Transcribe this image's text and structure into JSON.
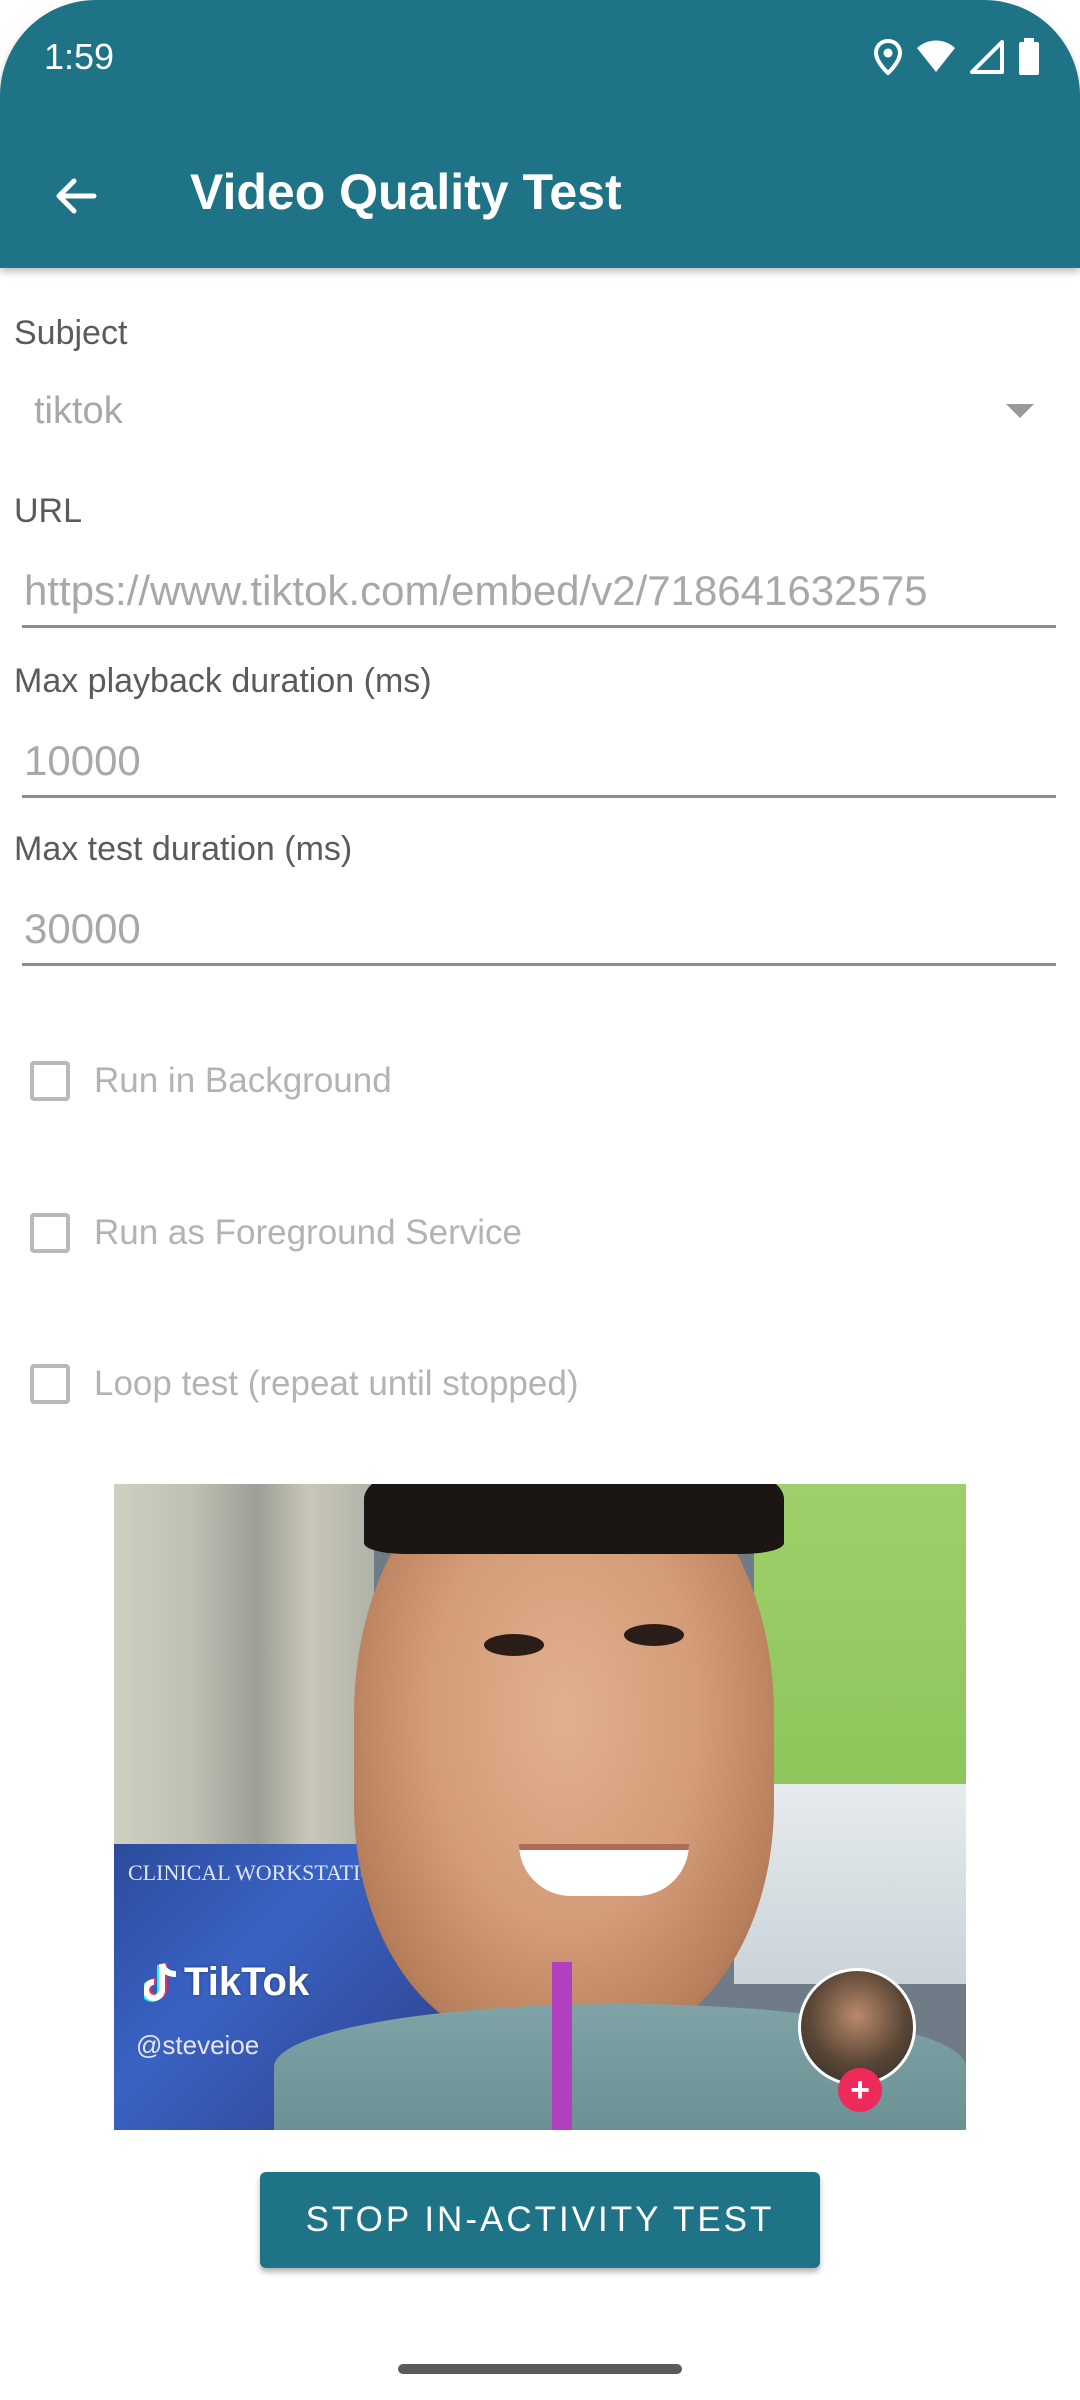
{
  "status_bar": {
    "time": "1:59",
    "icons": [
      "location-icon",
      "wifi-icon",
      "signal-icon",
      "battery-icon"
    ]
  },
  "app_bar": {
    "title": "Video Quality Test",
    "back_icon": "arrow-back-icon"
  },
  "form": {
    "subject": {
      "label": "Subject",
      "value": "tiktok"
    },
    "url": {
      "label": "URL",
      "value": "https://www.tiktok.com/embed/v2/718641632575"
    },
    "max_playback": {
      "label": "Max playback duration (ms)",
      "value": "10000"
    },
    "max_test": {
      "label": "Max test duration (ms)",
      "value": "30000"
    },
    "checkboxes": [
      {
        "label": "Run in Background",
        "checked": false
      },
      {
        "label": "Run as Foreground Service",
        "checked": false
      },
      {
        "label": "Loop test (repeat until stopped)",
        "checked": false
      }
    ]
  },
  "video": {
    "brand": "TikTok",
    "handle": "@steveioe",
    "monitor_text": "CLINICAL WORKSTATION"
  },
  "actions": {
    "stop_label": "STOP IN-ACTIVITY TEST"
  },
  "colors": {
    "primary": "#1E7486",
    "tiktok_plus": "#EE2A5A"
  }
}
